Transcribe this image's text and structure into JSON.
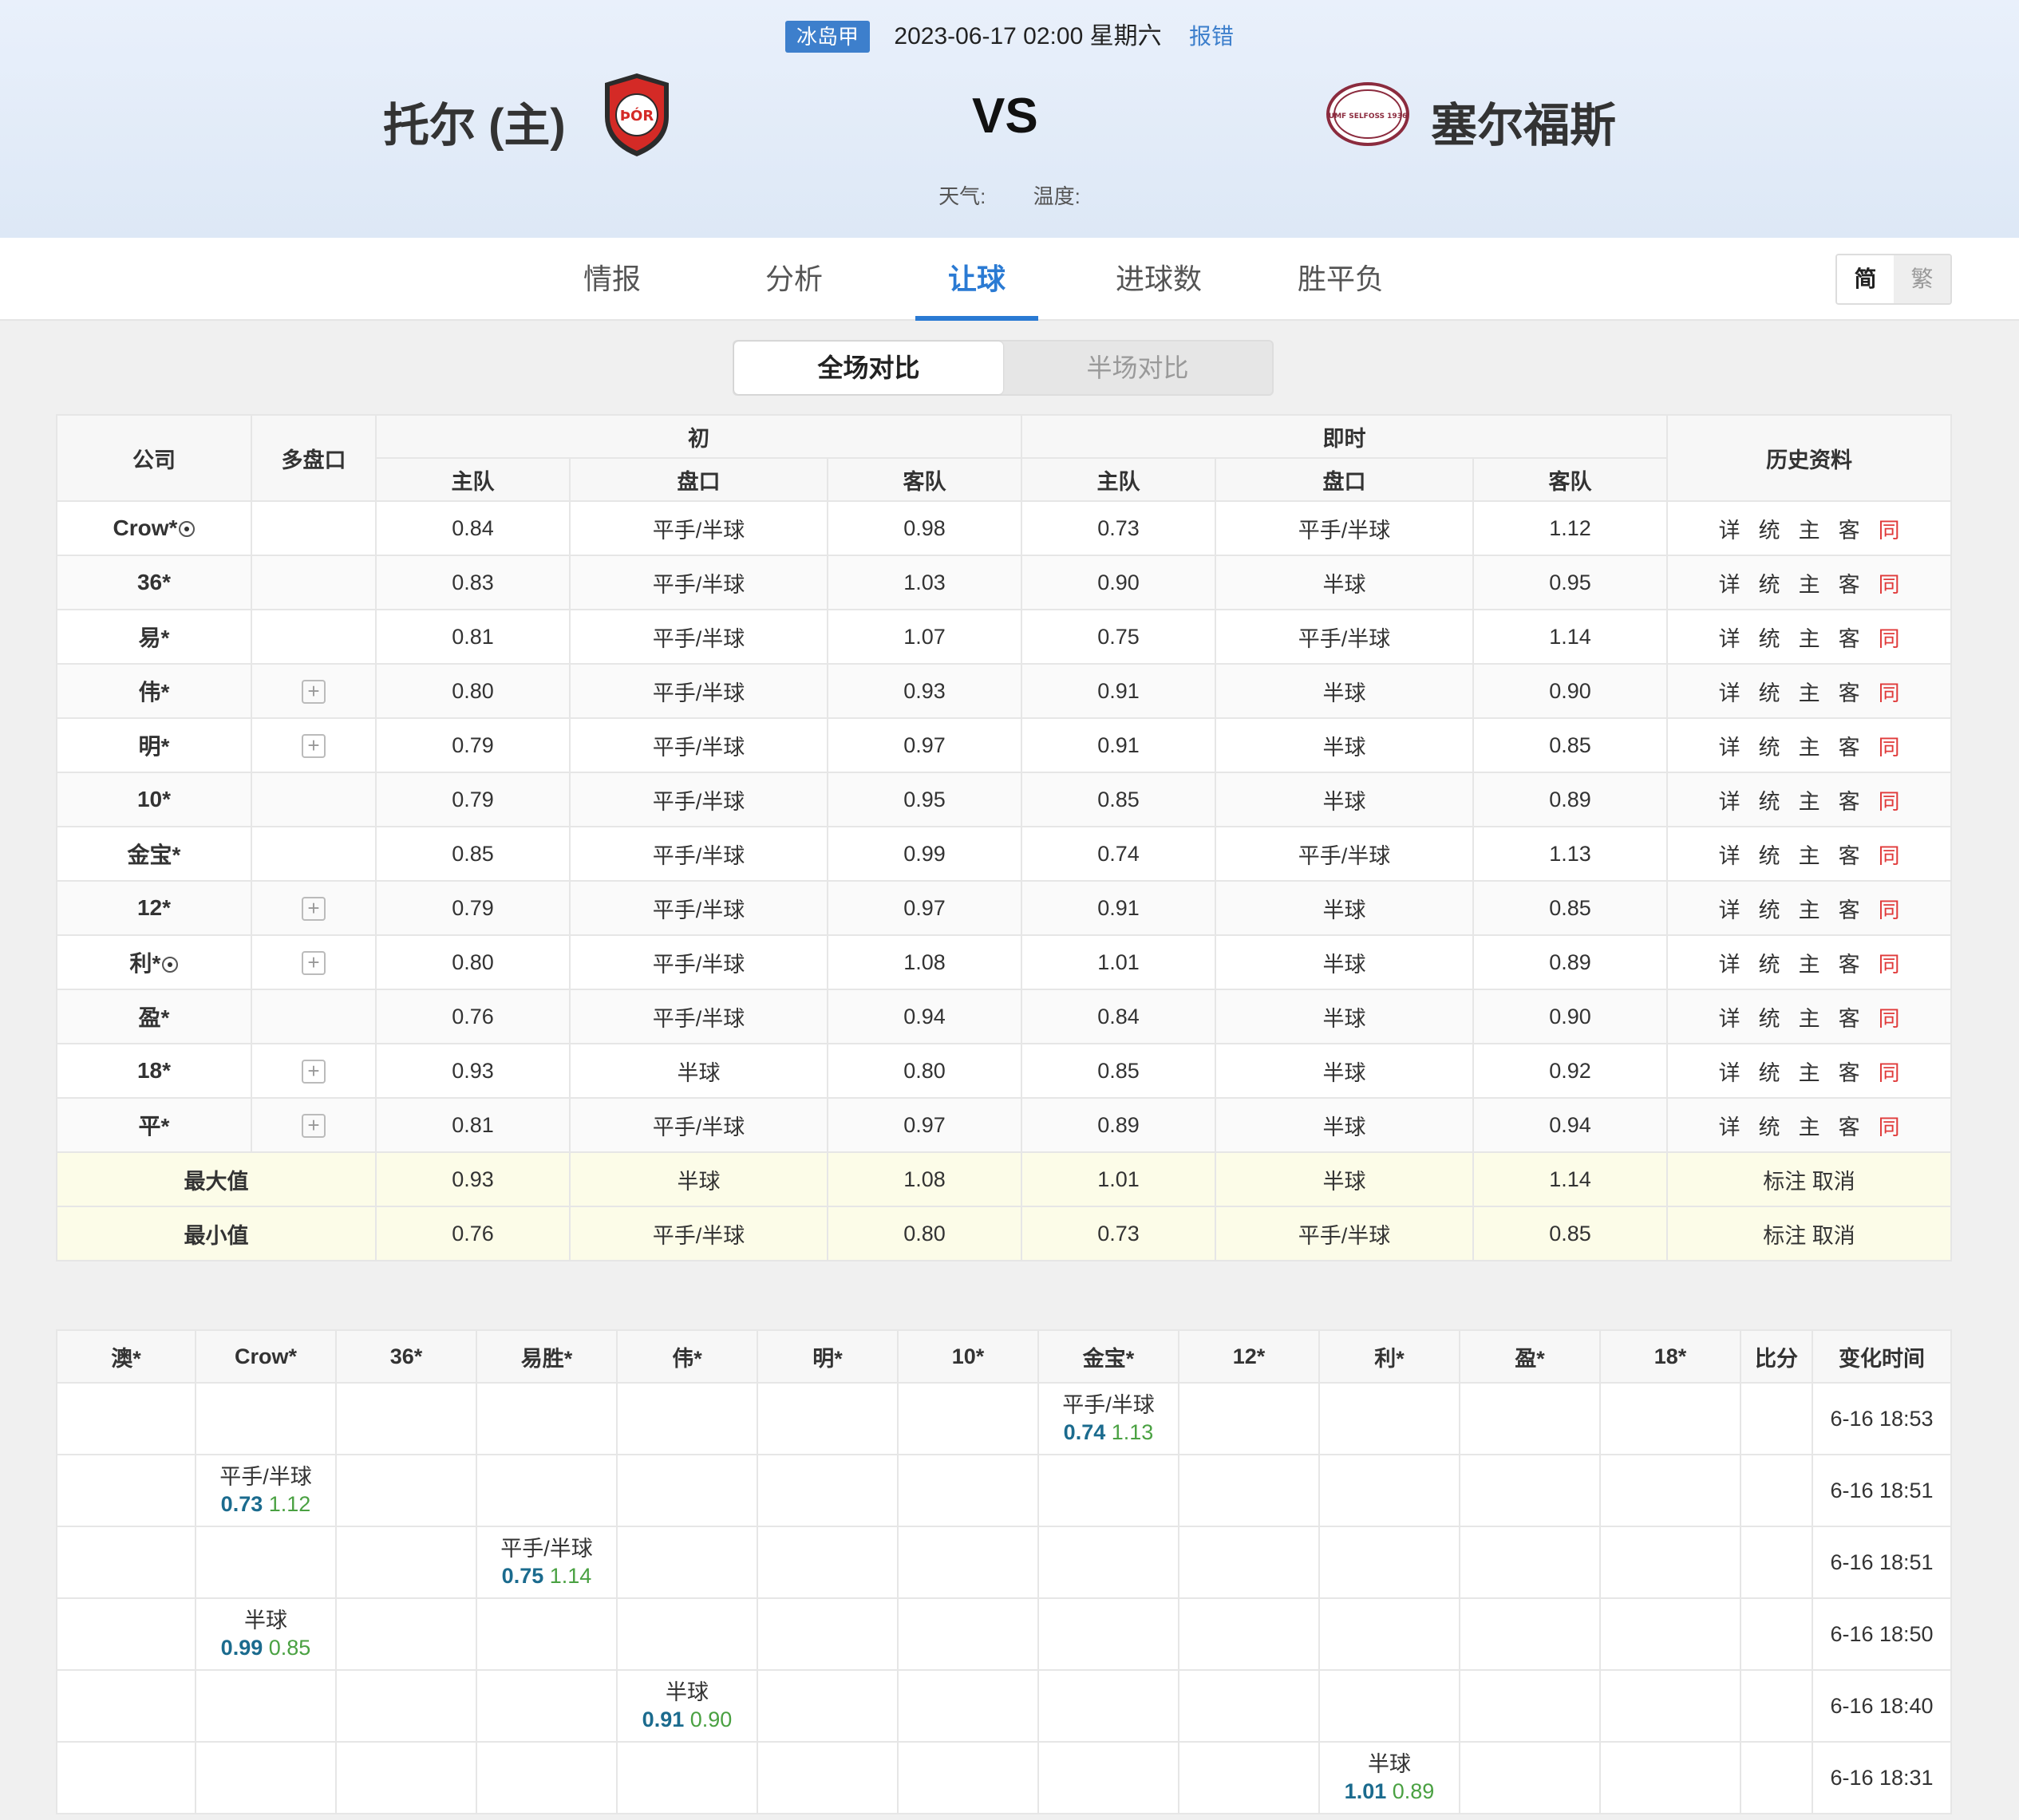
{
  "header": {
    "league": "冰岛甲",
    "datetime": "2023-06-17 02:00 星期六",
    "report": "报错",
    "home_team": "托尔 (主)",
    "away_team": "塞尔福斯",
    "vs": "VS",
    "weather_label": "天气:",
    "temp_label": "温度:",
    "away_logo_text": "UMF SELFOSS 1936",
    "home_logo_text": "ÞÓR"
  },
  "tabs": [
    "情报",
    "分析",
    "让球",
    "进球数",
    "胜平负"
  ],
  "active_tab": "让球",
  "lang": {
    "simplified": "简",
    "traditional": "繁"
  },
  "segment": {
    "full": "全场对比",
    "half": "半场对比"
  },
  "odds_table": {
    "headers": {
      "company": "公司",
      "multi": "多盘口",
      "initial": "初",
      "live": "即时",
      "history": "历史资料",
      "home": "主队",
      "handicap": "盘口",
      "away": "客队"
    },
    "link_labels": [
      "详",
      "统",
      "主",
      "客",
      "同"
    ],
    "rows": [
      {
        "company": "Crow*",
        "ball": true,
        "multi": false,
        "i": [
          "0.84",
          "平手/半球",
          "0.98"
        ],
        "l": [
          "0.73",
          "平手/半球",
          "1.12"
        ]
      },
      {
        "company": "36*",
        "ball": false,
        "multi": false,
        "i": [
          "0.83",
          "平手/半球",
          "1.03"
        ],
        "l": [
          "0.90",
          "半球",
          "0.95"
        ]
      },
      {
        "company": "易*",
        "ball": false,
        "multi": false,
        "i": [
          "0.81",
          "平手/半球",
          "1.07"
        ],
        "l": [
          "0.75",
          "平手/半球",
          "1.14"
        ]
      },
      {
        "company": "伟*",
        "ball": false,
        "multi": true,
        "i": [
          "0.80",
          "平手/半球",
          "0.93"
        ],
        "l": [
          "0.91",
          "半球",
          "0.90"
        ]
      },
      {
        "company": "明*",
        "ball": false,
        "multi": true,
        "i": [
          "0.79",
          "平手/半球",
          "0.97"
        ],
        "l": [
          "0.91",
          "半球",
          "0.85"
        ]
      },
      {
        "company": "10*",
        "ball": false,
        "multi": false,
        "i": [
          "0.79",
          "平手/半球",
          "0.95"
        ],
        "l": [
          "0.85",
          "半球",
          "0.89"
        ]
      },
      {
        "company": "金宝*",
        "ball": false,
        "multi": false,
        "i": [
          "0.85",
          "平手/半球",
          "0.99"
        ],
        "l": [
          "0.74",
          "平手/半球",
          "1.13"
        ]
      },
      {
        "company": "12*",
        "ball": false,
        "multi": true,
        "i": [
          "0.79",
          "平手/半球",
          "0.97"
        ],
        "l": [
          "0.91",
          "半球",
          "0.85"
        ]
      },
      {
        "company": "利*",
        "ball": true,
        "multi": true,
        "i": [
          "0.80",
          "平手/半球",
          "1.08"
        ],
        "l": [
          "1.01",
          "半球",
          "0.89"
        ]
      },
      {
        "company": "盈*",
        "ball": false,
        "multi": false,
        "i": [
          "0.76",
          "平手/半球",
          "0.94"
        ],
        "l": [
          "0.84",
          "半球",
          "0.90"
        ]
      },
      {
        "company": "18*",
        "ball": false,
        "multi": true,
        "i": [
          "0.93",
          "半球",
          "0.80"
        ],
        "l": [
          "0.85",
          "半球",
          "0.92"
        ]
      },
      {
        "company": "平*",
        "ball": false,
        "multi": true,
        "i": [
          "0.81",
          "平手/半球",
          "0.97"
        ],
        "l": [
          "0.89",
          "半球",
          "0.94"
        ]
      }
    ],
    "summary": [
      {
        "label": "最大值",
        "i": [
          "0.93",
          "半球",
          "1.08"
        ],
        "l": [
          "1.01",
          "半球",
          "1.14"
        ],
        "action": "标注 取消"
      },
      {
        "label": "最小值",
        "i": [
          "0.76",
          "平手/半球",
          "0.80"
        ],
        "l": [
          "0.73",
          "平手/半球",
          "0.85"
        ],
        "action": "标注 取消"
      }
    ]
  },
  "changes_table": {
    "headers": [
      "澳*",
      "Crow*",
      "36*",
      "易胜*",
      "伟*",
      "明*",
      "10*",
      "金宝*",
      "12*",
      "利*",
      "盈*",
      "18*",
      "比分",
      "变化时间"
    ],
    "rows": [
      {
        "col": 7,
        "handicap": "平手/半球",
        "home": "0.74",
        "away": "1.13",
        "time": "6-16 18:53"
      },
      {
        "col": 1,
        "handicap": "平手/半球",
        "home": "0.73",
        "away": "1.12",
        "time": "6-16 18:51"
      },
      {
        "col": 3,
        "handicap": "平手/半球",
        "home": "0.75",
        "away": "1.14",
        "time": "6-16 18:51"
      },
      {
        "col": 1,
        "handicap": "半球",
        "home": "0.99",
        "away": "0.85",
        "time": "6-16 18:50"
      },
      {
        "col": 4,
        "handicap": "半球",
        "home": "0.91",
        "away": "0.90",
        "time": "6-16 18:40"
      },
      {
        "col": 9,
        "handicap": "半球",
        "home": "1.01",
        "away": "0.89",
        "time": "6-16 18:31"
      }
    ]
  }
}
